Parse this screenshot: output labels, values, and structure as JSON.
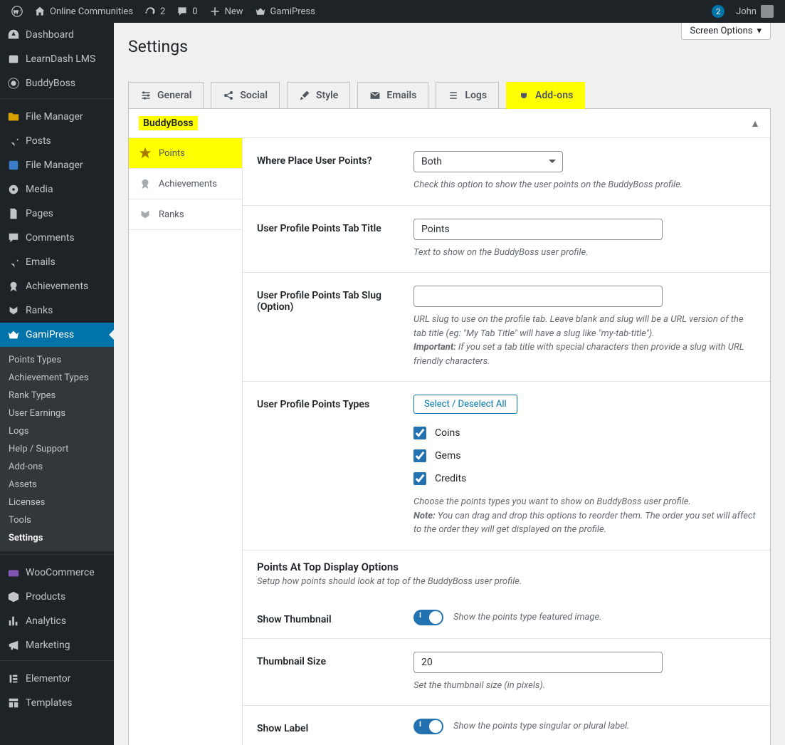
{
  "adminbar": {
    "site": "Online Communities",
    "refresh": "2",
    "comments": "0",
    "new": "New",
    "gp": "GamiPress",
    "notif": "2",
    "user": "John"
  },
  "menu": {
    "dashboard": "Dashboard",
    "learndash": "LearnDash LMS",
    "buddyboss": "BuddyBoss",
    "filemanager": "File Manager",
    "posts": "Posts",
    "filemanager2": "File Manager",
    "media": "Media",
    "pages": "Pages",
    "comments": "Comments",
    "emails": "Emails",
    "achievements": "Achievements",
    "ranks": "Ranks",
    "gamipress": "GamiPress",
    "woo": "WooCommerce",
    "products": "Products",
    "analytics": "Analytics",
    "marketing": "Marketing",
    "elementor": "Elementor",
    "templates": "Templates"
  },
  "submenu": {
    "points_types": "Points Types",
    "achievement_types": "Achievement Types",
    "rank_types": "Rank Types",
    "user_earnings": "User Earnings",
    "logs": "Logs",
    "help": "Help / Support",
    "addons": "Add-ons",
    "assets": "Assets",
    "licenses": "Licenses",
    "tools": "Tools",
    "settings": "Settings"
  },
  "page": {
    "title": "Settings",
    "screen_options": "Screen Options"
  },
  "tabs": {
    "general": "General",
    "social": "Social",
    "style": "Style",
    "emails": "Emails",
    "logs": "Logs",
    "addons": "Add-ons"
  },
  "panel": {
    "title": "BuddyBoss"
  },
  "sidetabs": {
    "points": "Points",
    "achievements": "Achievements",
    "ranks": "Ranks"
  },
  "fields": {
    "place": {
      "label": "Where Place User Points?",
      "value": "Both",
      "desc": "Check this option to show the user points on the BuddyBoss profile."
    },
    "tab_title": {
      "label": "User Profile Points Tab Title",
      "value": "Points",
      "desc": "Text to show on the BuddyBoss user profile."
    },
    "tab_slug": {
      "label": "User Profile Points Tab Slug (Option)",
      "value": "",
      "desc1": "URL slug to use on the profile tab. Leave blank and slug will be a URL version of the tab title (eg: \"My Tab Title\" will have a slug like \"my-tab-title\").",
      "desc2_b": "Important:",
      "desc2": " If you set a tab title with special characters then provide a slug with URL friendly characters."
    },
    "types": {
      "label": "User Profile Points Types",
      "btn": "Select / Deselect All",
      "opts": [
        "Coins",
        "Gems",
        "Credits"
      ],
      "desc1": "Choose the points types you want to show on BuddyBoss user profile.",
      "desc2_b": "Note:",
      "desc2": " You can drag and drop this options to reorder them. The order you set will affect to the order they will get displayed on the profile."
    },
    "section": {
      "title": "Points At Top Display Options",
      "sub": "Setup how points should look at top of the BuddyBoss user profile."
    },
    "thumb": {
      "label": "Show Thumbnail",
      "desc": "Show the points type featured image."
    },
    "thumb_size": {
      "label": "Thumbnail Size",
      "value": "20",
      "desc": "Set the thumbnail size (in pixels)."
    },
    "show_label": {
      "label": "Show Label",
      "desc": "Show the points type singular or plural label."
    }
  }
}
